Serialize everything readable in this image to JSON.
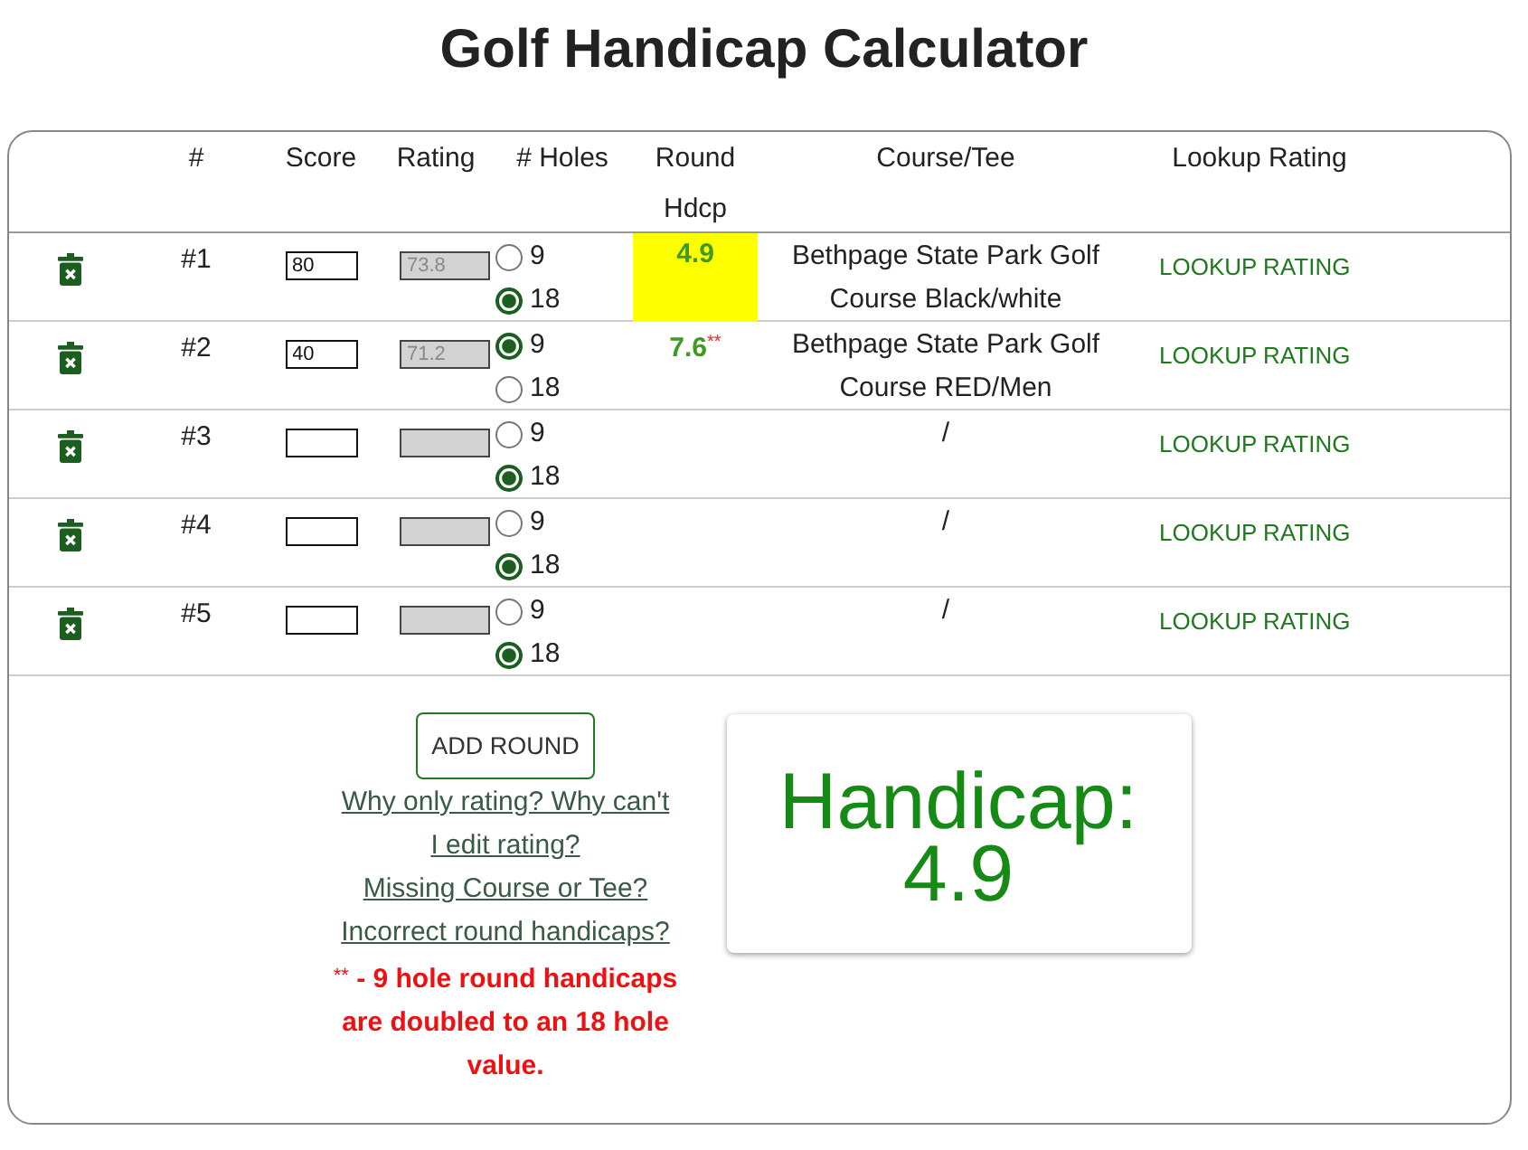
{
  "title": "Golf Handicap Calculator",
  "table": {
    "columns": [
      "#",
      "Score",
      "Rating",
      "# Holes",
      "Round Hdcp",
      "Course/Tee",
      "Lookup Rating"
    ],
    "rows": [
      {
        "number": "#1",
        "score": "80",
        "rating": "73.8",
        "holes": [
          {
            "label": "9",
            "selected": false
          },
          {
            "label": "18",
            "selected": true
          }
        ],
        "round_hdcp": "4.9",
        "highlighted": true,
        "course_tee": "Bethpage State Park Golf Course Black/white",
        "lookup": "LOOKUP RATING"
      },
      {
        "number": "#2",
        "score": "40",
        "rating": "71.2",
        "holes": [
          {
            "label": "9",
            "selected": true
          },
          {
            "label": "18",
            "selected": false
          }
        ],
        "round_hdcp": "7.6",
        "note_mark": "**",
        "highlighted": false,
        "course_tee": "Bethpage State Park Golf Course RED/Men",
        "lookup": "LOOKUP RATING"
      },
      {
        "number": "#3",
        "holes": [
          {
            "label": "9",
            "selected": false
          },
          {
            "label": "18",
            "selected": true
          }
        ],
        "highlighted": false,
        "course_tee": "/",
        "lookup": "LOOKUP RATING"
      },
      {
        "number": "#4",
        "holes": [
          {
            "label": "9",
            "selected": false
          },
          {
            "label": "18",
            "selected": true
          }
        ],
        "highlighted": false,
        "course_tee": "/",
        "lookup": "LOOKUP RATING"
      },
      {
        "number": "#5",
        "holes": [
          {
            "label": "9",
            "selected": false
          },
          {
            "label": "18",
            "selected": true
          }
        ],
        "highlighted": false,
        "course_tee": "/",
        "lookup": "LOOKUP RATING"
      }
    ]
  },
  "actions": {
    "add_button": "ADD ROUND",
    "help_links": [
      "Why only rating? Why can't I edit rating?",
      "Missing Course or Tee?",
      "Incorrect round handicaps?"
    ],
    "footnote": {
      "mark": "**",
      "text": "- 9 hole round handicaps are doubled to an 18 hole value."
    }
  },
  "result": {
    "label": "Handicap:",
    "value": "4.9"
  }
}
